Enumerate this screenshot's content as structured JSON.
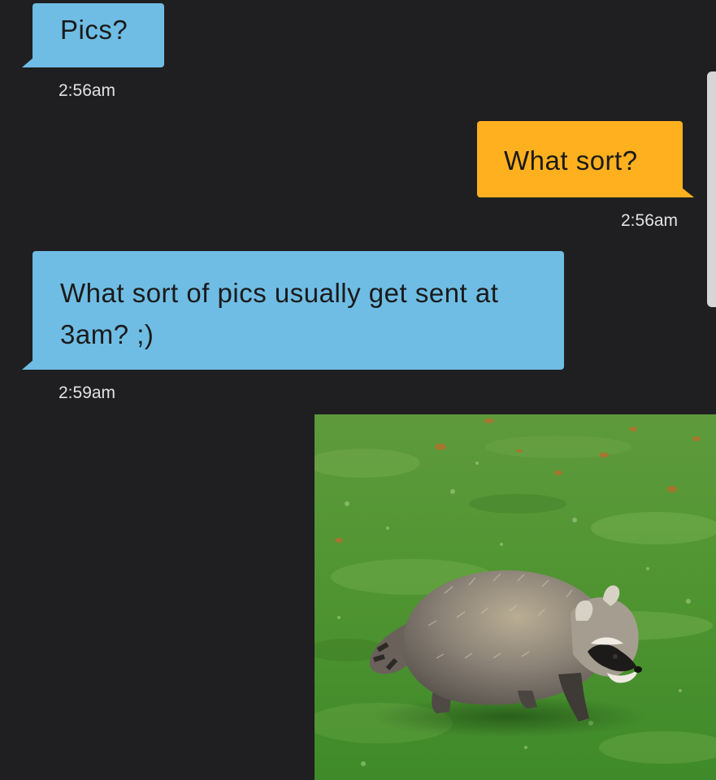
{
  "conversation": {
    "messages": [
      {
        "sender": "them",
        "text": "Pics?",
        "time": "2:56am"
      },
      {
        "sender": "me",
        "text": "What sort?",
        "time": "2:56am"
      },
      {
        "sender": "them",
        "text": "What sort of pics usually get sent at 3am? ;)",
        "time": "2:59am"
      }
    ],
    "attachment": {
      "type": "photo",
      "subject": "raccoon-walking-on-grass"
    }
  },
  "colors": {
    "background": "#1f1f21",
    "incoming_bubble": "#6fbde4",
    "outgoing_bubble": "#ffb01e",
    "timestamp_text": "#e2e2e2"
  }
}
